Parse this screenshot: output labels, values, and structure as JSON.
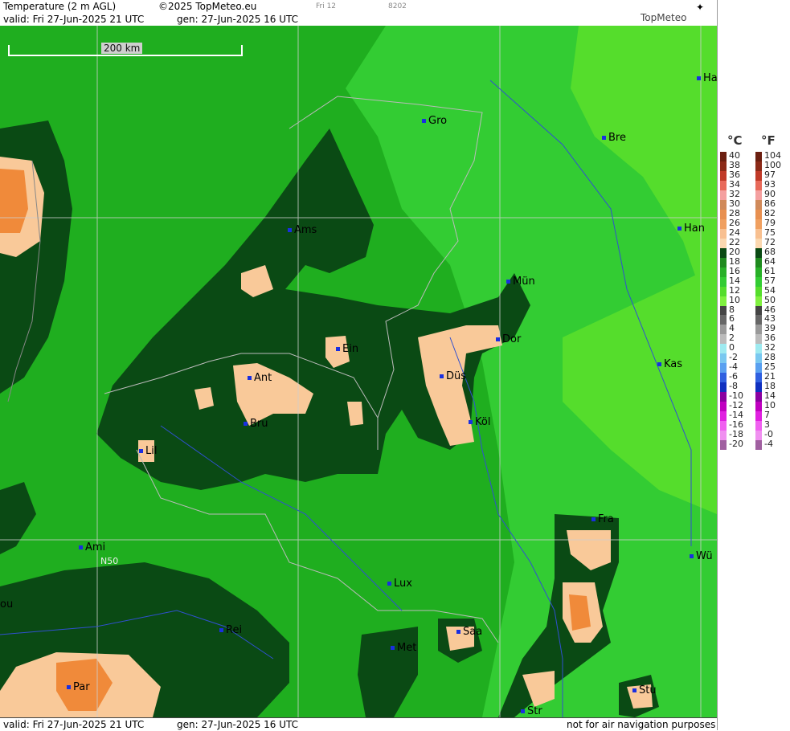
{
  "header": {
    "title": "Temperature (2 m AGL)",
    "copyright": "©2025 TopMeteo.eu",
    "step": "Fri 12",
    "code": "8202",
    "valid": "valid:  Fri  27-Jun-2025  21 UTC",
    "gen": "gen: 27-Jun-2025 16 UTC"
  },
  "logo": "TopMeteo",
  "footer": {
    "valid": "valid:  Fri  27-Jun-2025  21 UTC",
    "gen": "gen: 27-Jun-2025 16 UTC",
    "disclaimer": "not for air navigation purposes"
  },
  "scale_label": "200 km",
  "lat_label": "N50",
  "cities": [
    "Gro",
    "Bre",
    "Ha",
    "Ams",
    "Han",
    "Mün",
    "Ein",
    "Dor",
    "Ant",
    "Düs",
    "Kas",
    "Bru",
    "Köl",
    "Lil",
    "Fra",
    "Ami",
    "Wü",
    "Lux",
    "ou",
    "Rei",
    "Saa",
    "Met",
    "Par",
    "Stu",
    "Str"
  ],
  "colors": {
    "background_green": "#1fae1f",
    "light_green": "#33cc33",
    "bright_green": "#55dd2c",
    "dark_green": "#0a4a14",
    "warm_tan": "#f9c999",
    "orange": "#f08a3a",
    "city_marker": "#1a2fe0"
  },
  "legend": {
    "unit_c": "°C",
    "unit_f": "°F",
    "celsius": [
      "40",
      "38",
      "36",
      "34",
      "32",
      "30",
      "28",
      "26",
      "24",
      "22",
      "20",
      "18",
      "16",
      "14",
      "12",
      "10",
      "8",
      "6",
      "4",
      "2",
      "0",
      "-2",
      "-4",
      "-6",
      "-8",
      "-10",
      "-12",
      "-14",
      "-16",
      "-18",
      "-20"
    ],
    "fahrenheit": [
      "104",
      "100",
      "97",
      "93",
      "90",
      "86",
      "82",
      "79",
      "75",
      "72",
      "68",
      "64",
      "61",
      "57",
      "54",
      "50",
      "46",
      "43",
      "39",
      "36",
      "32",
      "28",
      "25",
      "21",
      "18",
      "14",
      "10",
      "7",
      "3",
      "-0",
      "-4"
    ],
    "colors": [
      "#6b1f10",
      "#8c2a18",
      "#c03a28",
      "#e86a5a",
      "#f4a0a0",
      "#d08a5a",
      "#e89050",
      "#f0a060",
      "#f8c090",
      "#fbd8b0",
      "#0a4a14",
      "#1f8a1f",
      "#28b028",
      "#33cc33",
      "#55dd2c",
      "#80f040",
      "#444444",
      "#666666",
      "#999999",
      "#bbbbbb",
      "#9eeaf0",
      "#7ac8f0",
      "#5aa0f0",
      "#3060e0",
      "#1030c0",
      "#8a00a0",
      "#c000c0",
      "#e020e0",
      "#f060f0",
      "#f090f0",
      "#a060a0"
    ]
  }
}
